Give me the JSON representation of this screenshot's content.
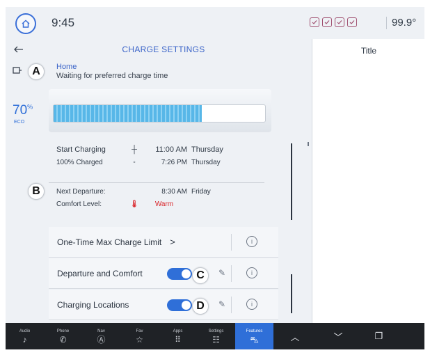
{
  "status_bar": {
    "time": "9:45",
    "temperature": "99.9°",
    "home_icon": "home-icon"
  },
  "header": {
    "title": "CHARGE SETTINGS"
  },
  "location": {
    "name": "Home",
    "status": "Waiting for preferred charge time"
  },
  "battery": {
    "percent": "70",
    "percent_unit": "%",
    "range_text": "ECO",
    "charge_fraction": 0.7
  },
  "schedule": {
    "start_label": "Start Charging",
    "start_time": "11:00 AM",
    "start_day": "Thursday",
    "full_label": "100% Charged",
    "full_time": "7:26 PM",
    "full_day": "Thursday",
    "departure_label": "Next Departure:",
    "departure_time": "8:30 AM",
    "departure_day": "Friday",
    "comfort_label": "Comfort Level:",
    "comfort_value": "Warm"
  },
  "list": {
    "max_charge_label": "One-Time Max Charge Limit",
    "max_charge_chevron": ">",
    "departure_comfort_label": "Departure and Comfort",
    "charging_locations_label": "Charging Locations",
    "departure_comfort_on": true,
    "charging_locations_on": true
  },
  "right_panel": {
    "title": "Title"
  },
  "markers": {
    "a": "A",
    "b": "B",
    "c": "C",
    "d": "D"
  },
  "nav": {
    "audio": "Audio",
    "phone": "Phone",
    "nav": "Nav",
    "fav": "Fav",
    "apps": "Apps",
    "settings": "Settings",
    "features": "Features"
  },
  "colors": {
    "accent": "#2f6fd8",
    "charge_fill": "#58b7e8",
    "warm": "#d9262b",
    "nav_bg": "#1f2226"
  }
}
